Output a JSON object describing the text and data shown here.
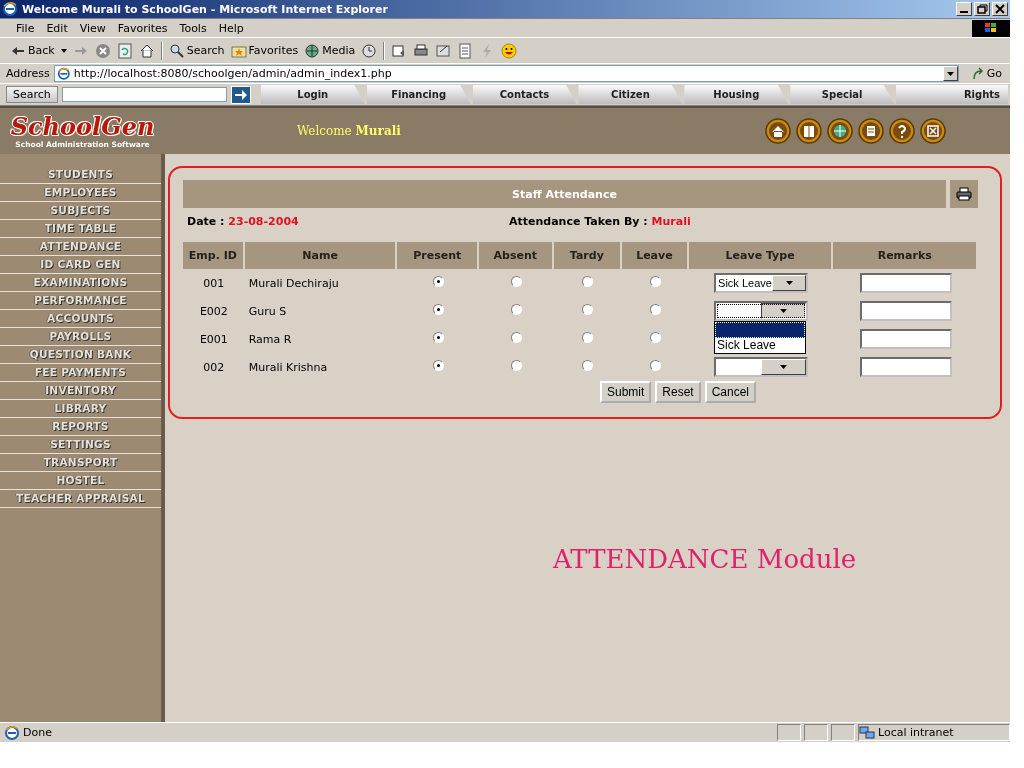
{
  "window": {
    "title": "Welcome Murali to SchoolGen - Microsoft Internet Explorer"
  },
  "menu": [
    "File",
    "Edit",
    "View",
    "Favorites",
    "Tools",
    "Help"
  ],
  "toolbar": {
    "back": "Back",
    "search": "Search",
    "favorites": "Favorites",
    "media": "Media"
  },
  "address": {
    "label": "Address",
    "url": "http://localhost:8080/schoolgen/admin/admin_index1.php",
    "go": "Go"
  },
  "links_bar": {
    "search_label": "Search",
    "tabs": [
      "Login",
      "Financing",
      "Contacts",
      "Citizen",
      "Housing",
      "Special",
      "Rights"
    ]
  },
  "header": {
    "logo": "SchoolGen",
    "tagline": "School Administration Software",
    "welcome": "Welcome",
    "user": "Murali"
  },
  "sidebar": {
    "items": [
      "STUDENTS",
      "EMPLOYEES",
      "SUBJECTS",
      "TIME TABLE",
      "ATTENDANCE",
      "ID CARD GEN",
      "EXAMINATIONS",
      "PERFORMANCE",
      "ACCOUNTS",
      "PAYROLLS",
      "QUESTION BANK",
      "FEE PAYMENTS",
      "INVENTORY",
      "LIBRARY",
      "REPORTS",
      "SETTINGS",
      "TRANSPORT",
      "HOSTEL",
      "TEACHER APPRAISAL"
    ]
  },
  "attendance": {
    "title": "Staff Attendance",
    "date_label": "Date :",
    "date": "23-08-2004",
    "taken_by_label": "Attendance Taken By :",
    "taken_by": "Murali",
    "columns": [
      "Emp. ID",
      "Name",
      "Present",
      "Absent",
      "Tardy",
      "Leave",
      "Leave Type",
      "Remarks"
    ],
    "rows": [
      {
        "emp_id": "001",
        "name": "Murali Dechiraju",
        "present": true,
        "absent": false,
        "tardy": false,
        "leave": false,
        "leave_select": {
          "value": "Sick Leave",
          "expanded": false
        }
      },
      {
        "emp_id": "E002",
        "name": "Guru S",
        "present": true,
        "absent": false,
        "tardy": false,
        "leave": false,
        "leave_select": {
          "expanded": true,
          "options": [
            "Sick Leave"
          ]
        }
      },
      {
        "emp_id": "E001",
        "name": "Rama R",
        "present": true,
        "absent": false,
        "tardy": false,
        "leave": false
      },
      {
        "emp_id": "002",
        "name": "Murali Krishna",
        "present": true,
        "absent": false,
        "tardy": false,
        "leave": false,
        "leave_select": {
          "expanded": false
        }
      }
    ],
    "buttons": [
      "Submit",
      "Reset",
      "Cancel"
    ]
  },
  "caption": "ATTENDANCE Module",
  "status_bar": {
    "text": "Done",
    "zone": "Local intranet"
  }
}
